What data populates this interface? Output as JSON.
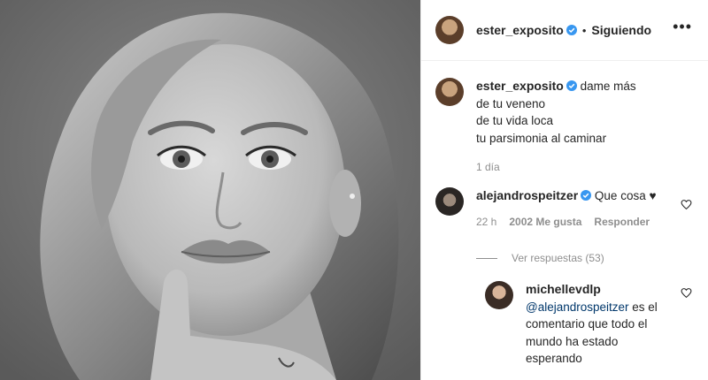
{
  "post": {
    "author": "ester_exposito",
    "follow_status": "Siguiendo",
    "more_icon": "•••"
  },
  "caption": {
    "author": "ester_exposito",
    "lines": [
      "dame más",
      "de tu veneno",
      "de tu vida loca",
      "tu parsimonia al caminar"
    ],
    "time": "1 día"
  },
  "comments": [
    {
      "author": "alejandrospeitzer",
      "text": "Que cosa",
      "emoji": "♥",
      "time": "22 h",
      "likes": "2002 Me gusta",
      "reply_label": "Responder",
      "view_replies": "Ver respuestas (53)"
    }
  ],
  "reply": {
    "author": "michellevdlp",
    "mention": "@alejandrospeitzer",
    "text_1": " es el",
    "text_2": "comentario que todo el",
    "text_3": "mundo ha estado",
    "text_4": "esperando"
  },
  "colors": {
    "verified": "#3897f0",
    "muted": "#8e8e8e",
    "border": "#efefef"
  }
}
